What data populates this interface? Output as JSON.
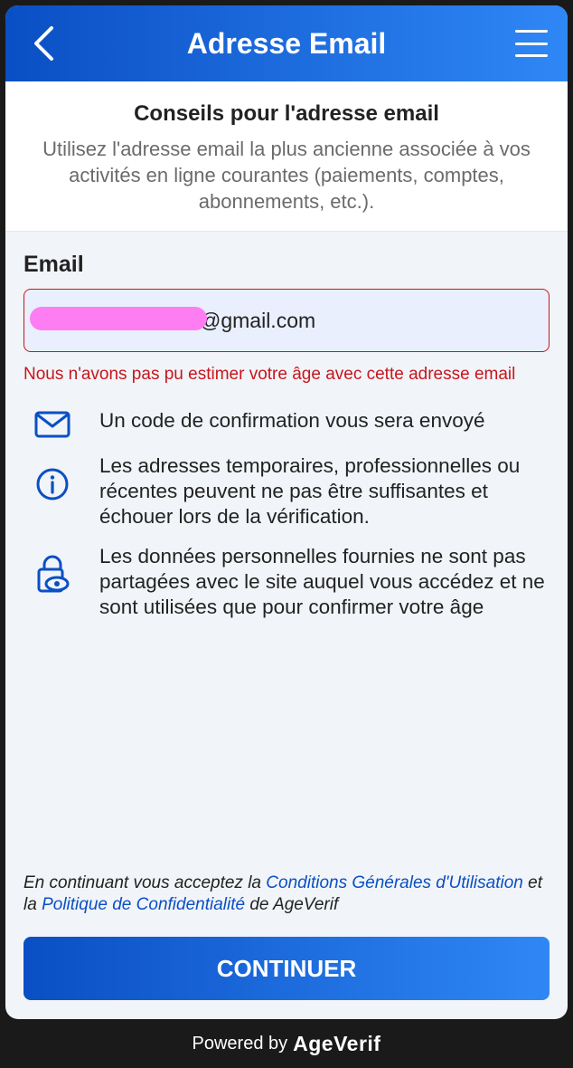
{
  "header": {
    "title": "Adresse Email",
    "back_icon": "chevron-left-icon",
    "menu_icon": "hamburger-menu-icon"
  },
  "tips": {
    "title": "Conseils pour l'adresse email",
    "text": "Utilisez l'adresse email la plus ancienne associée à vos activités en ligne courantes (paiements, comptes, abonnements, etc.)."
  },
  "form": {
    "label": "Email",
    "value": "@gmail.com",
    "error": "Nous n'avons pas pu estimer votre âge avec cette adresse email"
  },
  "info": [
    {
      "icon": "envelope-icon",
      "text": "Un code de confirmation vous sera envoyé"
    },
    {
      "icon": "info-icon",
      "text": "Les adresses temporaires, professionnelles ou récentes peuvent ne pas être suffisantes et échouer lors de la vérification."
    },
    {
      "icon": "lock-eye-icon",
      "text": "Les données personnelles fournies ne sont pas partagées avec le site auquel vous accédez et ne sont utilisées que pour confirmer votre âge"
    }
  ],
  "consent": {
    "prefix": "En continuant vous acceptez la",
    "terms_link": "Conditions Générales d'Utilisation",
    "middle": "et la",
    "privacy_link": "Politique de Confidentialité",
    "suffix": "de AgeVerif"
  },
  "continue_label": "CONTINUER",
  "footer": {
    "powered_by": "Powered by",
    "brand": "AgeVerif"
  },
  "colors": {
    "primary": "#0a4fc4",
    "primary_light": "#2f87f5",
    "error": "#c7161c",
    "input_bg": "#e9effd"
  }
}
